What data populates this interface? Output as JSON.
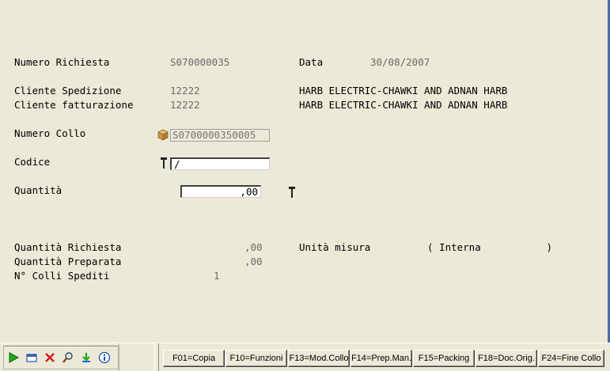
{
  "header": {
    "numero_richiesta_label": "Numero Richiesta",
    "numero_richiesta_value": "S070000035",
    "data_label": "Data",
    "data_value": "30/08/2007"
  },
  "clients": {
    "spedizione_label": "Cliente Spedizione",
    "spedizione_code": "12222",
    "spedizione_name": "HARB ELECTRIC-CHAWKI AND ADNAN HARB",
    "fatturazione_label": "Cliente fatturazione",
    "fatturazione_code": "12222",
    "fatturazione_name": "HARB ELECTRIC-CHAWKI AND ADNAN HARB"
  },
  "form": {
    "numero_collo_label": "Numero Collo",
    "numero_collo_value": "S0700000350005",
    "codice_label": "Codice",
    "codice_value": "/",
    "quantita_label": "Quantità",
    "quantita_value": ",00"
  },
  "summary": {
    "qta_richiesta_label": "Quantità Richiesta",
    "qta_richiesta_value": ",00",
    "qta_preparata_label": "Quantità Preparata",
    "qta_preparata_value": ",00",
    "colli_spediti_label": "N° Colli Spediti",
    "colli_spediti_value": "1",
    "unita_misura_label": "Unità misura",
    "unita_misura_value": "( Interna           )"
  },
  "toolbar": {
    "icons": [
      "play-icon",
      "window-icon",
      "delete-icon",
      "search-icon",
      "refresh-icon",
      "info-icon"
    ]
  },
  "function_keys": [
    "F01=Copia",
    "F10=Funzioni",
    "F13=Mod.Collo",
    "F14=Prep.Man.",
    "F15=Packing",
    "F18=Doc.Orig.",
    "F24=Fine Collo"
  ],
  "colors": {
    "background": "#ECE9D8",
    "value_text": "#6b6b6b",
    "edge": "#4a6fa8"
  }
}
